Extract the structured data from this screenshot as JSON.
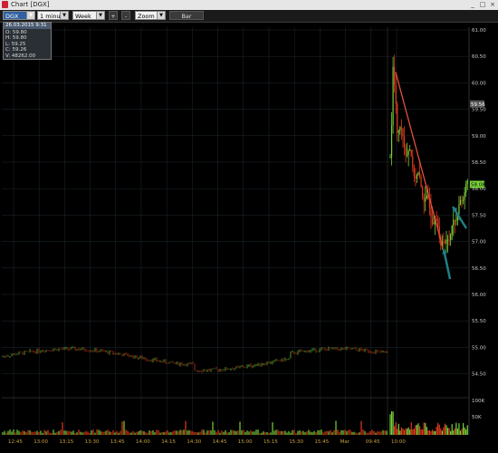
{
  "window": {
    "title": "Chart [DGX]",
    "minimize": "_",
    "maximize": "□",
    "close": "×"
  },
  "toolbar": {
    "symbol": "DGX",
    "interval": "1 minute",
    "period": "Week",
    "plus": "+",
    "minus": "-",
    "zoom": "Zoom",
    "bar": "Bar"
  },
  "info_box": {
    "header": "26.03.2015 9:31",
    "open": "O: 59.80",
    "high": "H: 59.80",
    "low": "L: 59.25",
    "close": "C: 59.26",
    "volume": "V: 48262.00"
  },
  "colors": {
    "up": "#78d23a",
    "down": "#e23a1c",
    "trendline": "#e0503a",
    "arrow": "#1f7f86",
    "grid": "#1e2a30",
    "axis_text": "#c8c8c8",
    "time_text": "#c8a040"
  },
  "chart_data": {
    "type": "candlestick",
    "symbol": "DGX",
    "interval": "1 minute",
    "price_axis": [
      "61.00",
      "60.50",
      "60.00",
      "59.50",
      "59.00",
      "58.50",
      "58.00",
      "57.50",
      "57.00",
      "56.50",
      "56.00",
      "55.50",
      "55.00",
      "54.50"
    ],
    "current_price_marker": "59.56",
    "last_price": "58.08",
    "volume_axis": [
      "100K",
      "50K"
    ],
    "time_axis": [
      "12:45",
      "13:00",
      "13:15",
      "13:30",
      "13:45",
      "14:00",
      "14:15",
      "14:30",
      "14:45",
      "15:00",
      "15:15",
      "15:30",
      "15:45",
      "Mar",
      "09:45",
      "10:00"
    ],
    "prior_day": {
      "price_range": [
        54.65,
        55.05
      ],
      "note": "flat session around 54.8"
    },
    "gap_open": {
      "open_high": 60.5,
      "peak": 60.2,
      "low": 56.95,
      "last": 58.08
    },
    "annotations": [
      "downward trendline from 60.2 to 56.95",
      "two arrows marking the bottom and rebound"
    ]
  }
}
